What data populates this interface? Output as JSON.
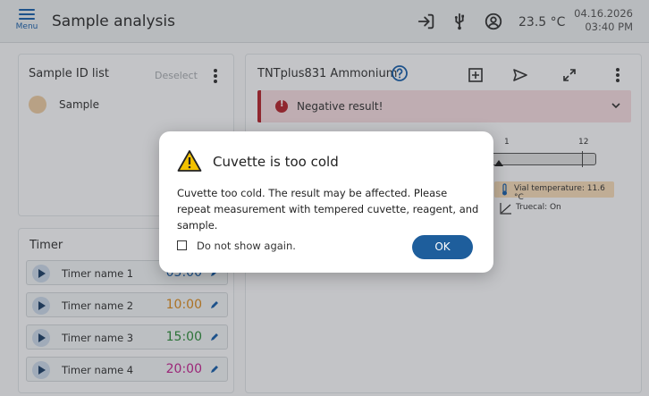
{
  "header": {
    "menu_label": "Menu",
    "title": "Sample analysis",
    "icons": [
      "login-icon",
      "usb-icon",
      "user-circle-icon"
    ],
    "temperature": "23.5 °C",
    "date": "04.16.2026",
    "time": "03:40 PM"
  },
  "sample_panel": {
    "title": "Sample ID list",
    "deselect_label": "Deselect",
    "items": [
      {
        "label": "Sample",
        "color": "#e8c9a0"
      }
    ]
  },
  "timer_panel": {
    "title": "Timer",
    "timers": [
      {
        "name": "Timer name 1",
        "value": "05:00",
        "color": "#1a5fa8"
      },
      {
        "name": "Timer name 2",
        "value": "10:00",
        "color": "#d98a1f"
      },
      {
        "name": "Timer name 3",
        "value": "15:00",
        "color": "#2e8b3a"
      },
      {
        "name": "Timer name 4",
        "value": "20:00",
        "color": "#c2248f"
      }
    ]
  },
  "result_panel": {
    "title": "TNTplus831 Ammonium",
    "banner_text": "Negative result!",
    "scale_labels": [
      "1",
      "12"
    ],
    "vial_temperature": "Vial temperature: 11.6 °C",
    "truecal": "Truecal: On"
  },
  "dialog": {
    "title": "Cuvette is too cold",
    "message": "Cuvette too cold. The result may be affected. Please repeat measurement with tempered cuvette, reagent, and sample.",
    "checkbox_label": "Do not show again.",
    "ok_label": "OK"
  },
  "colors": {
    "accent": "#1e5e9c",
    "error": "#b3262e",
    "warning": "#f2c100"
  }
}
